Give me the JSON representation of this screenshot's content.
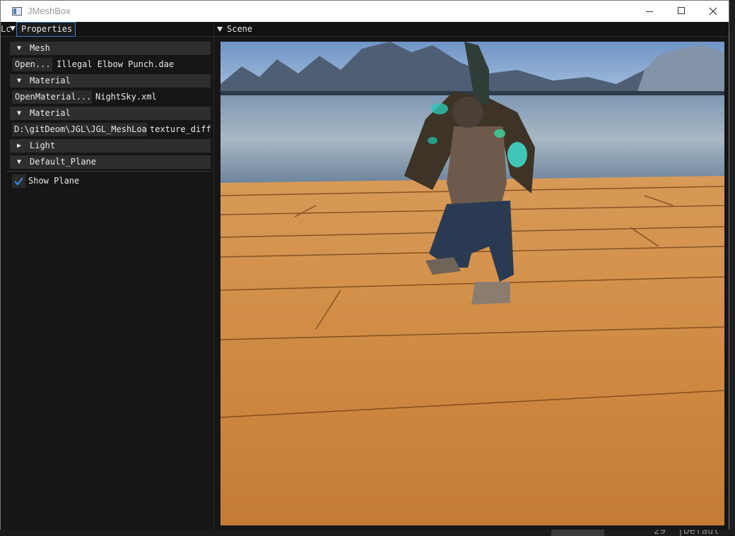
{
  "window": {
    "title": "JMeshBox"
  },
  "tabs": {
    "left_stub": "Lc",
    "properties": "Properties",
    "scene": "Scene"
  },
  "properties": {
    "mesh": {
      "header": "Mesh",
      "open_button": "Open...",
      "file": "Illegal Elbow Punch.dae"
    },
    "material1": {
      "header": "Material",
      "open_button": "OpenMaterial...",
      "file": "NightSky.xml"
    },
    "material2": {
      "header": "Material",
      "path_value": "D:\\gitDeom\\JGL\\JGL_MeshLoad",
      "texture_label": "texture_diffu"
    },
    "light": {
      "header": "Light",
      "collapsed": true
    },
    "plane": {
      "header": "Default_Plane",
      "show_plane_label": "Show Plane",
      "show_plane_checked": true
    }
  },
  "background_editor": {
    "line_number": "29",
    "snippet": "Defaul"
  },
  "colors": {
    "accent": "#3b7fd0",
    "panel": "#161616",
    "header": "#2e2e2e"
  },
  "icons": {
    "expanded": "▼",
    "collapsed": "▶"
  }
}
